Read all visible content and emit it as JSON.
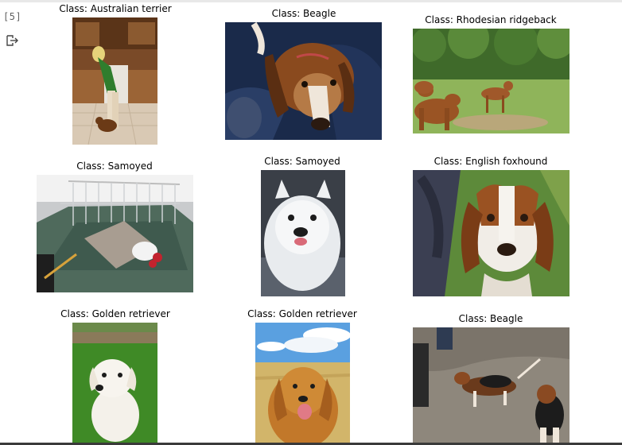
{
  "cell": {
    "execution_count": "[5]",
    "output_icon": "output-arrow-icon"
  },
  "images": [
    {
      "label": "Class: Australian terrier",
      "subject": "person-with-small-dog-kitchen"
    },
    {
      "label": "Class: Beagle",
      "subject": "beagle-on-blue-couch"
    },
    {
      "label": "Class: Rhodesian ridgeback",
      "subject": "ridgebacks-in-field"
    },
    {
      "label": "Class: Samoyed",
      "subject": "dog-in-playpen"
    },
    {
      "label": "Class: Samoyed",
      "subject": "white-fluffy-dog"
    },
    {
      "label": "Class: English foxhound",
      "subject": "foxhound-painting"
    },
    {
      "label": "Class: Golden retriever",
      "subject": "white-dog-on-grass"
    },
    {
      "label": "Class: Golden retriever",
      "subject": "golden-retriever-field"
    },
    {
      "label": "Class: Beagle",
      "subject": "beagles-on-dirt"
    }
  ]
}
